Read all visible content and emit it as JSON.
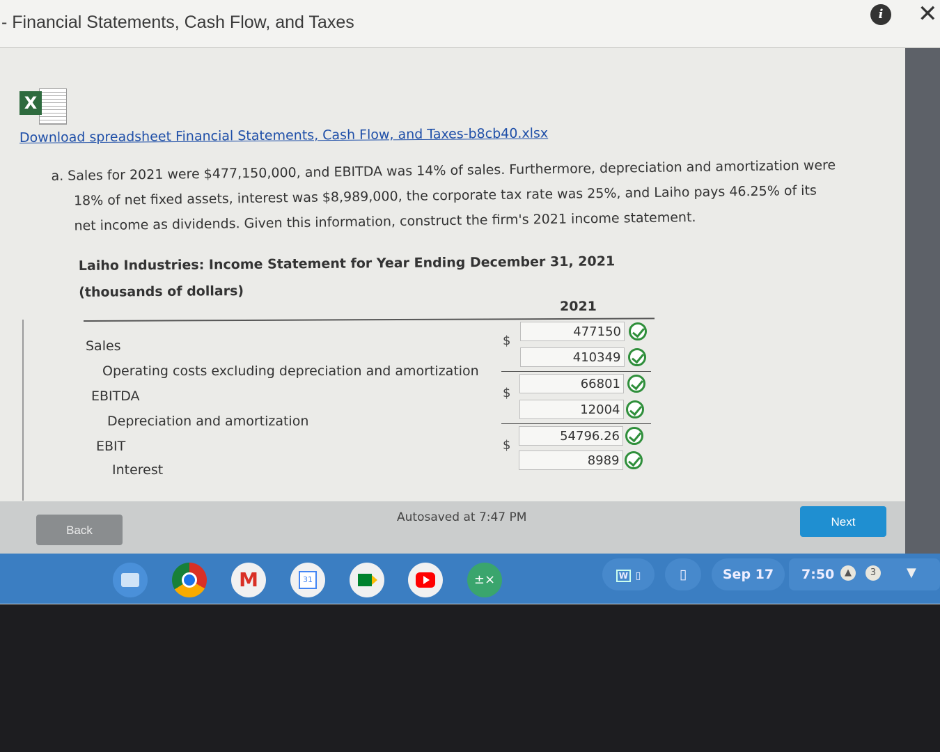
{
  "window": {
    "title": "- Financial Statements, Cash Flow, and Taxes",
    "info_icon": "info-icon",
    "close_icon": "close-icon"
  },
  "download": {
    "icon": "excel-icon",
    "link_text": "Download spreadsheet Financial Statements, Cash Flow, and Taxes-b8cb40.xlsx"
  },
  "question": {
    "line1": "a. Sales for 2021 were $477,150,000, and EBITDA was 14% of sales. Furthermore, depreciation and amortization were",
    "line2": "18% of net fixed assets, interest was $8,989,000, the corporate tax rate was 25%, and Laiho pays 46.25% of its",
    "line3": "net income as dividends. Given this information, construct the firm's 2021 income statement."
  },
  "statement": {
    "title": "Laiho Industries: Income Statement for Year Ending December 31, 2021",
    "subtitle": "(thousands of dollars)",
    "year_header": "2021",
    "rows": [
      {
        "label": "Sales",
        "currency": "$",
        "value": "477150",
        "status": "correct"
      },
      {
        "label": "Operating costs excluding depreciation and amortization",
        "currency": "",
        "value": "410349",
        "status": "correct"
      },
      {
        "label": "EBITDA",
        "currency": "$",
        "value": "66801",
        "status": "correct"
      },
      {
        "label": "Depreciation and amortization",
        "currency": "",
        "value": "12004",
        "status": "correct"
      },
      {
        "label": "EBIT",
        "currency": "$",
        "value": "54796.26",
        "status": "correct"
      },
      {
        "label": "Interest",
        "currency": "",
        "value": "8989",
        "status": "correct"
      }
    ]
  },
  "footer": {
    "back_label": "Back",
    "autosave": "Autosaved at 7:47 PM",
    "next_label": "Next"
  },
  "taskbar": {
    "apps": [
      "files",
      "chrome",
      "gmail",
      "calendar",
      "meet",
      "youtube",
      "calculator"
    ],
    "calendar_day": "31",
    "date": "Sep 17",
    "time": "7:50",
    "notification_count": "3"
  },
  "colors": {
    "link": "#1f4fa8",
    "check": "#2f8f3b",
    "next_button": "#1f8fd1",
    "taskbar": "#3b7ec2"
  }
}
